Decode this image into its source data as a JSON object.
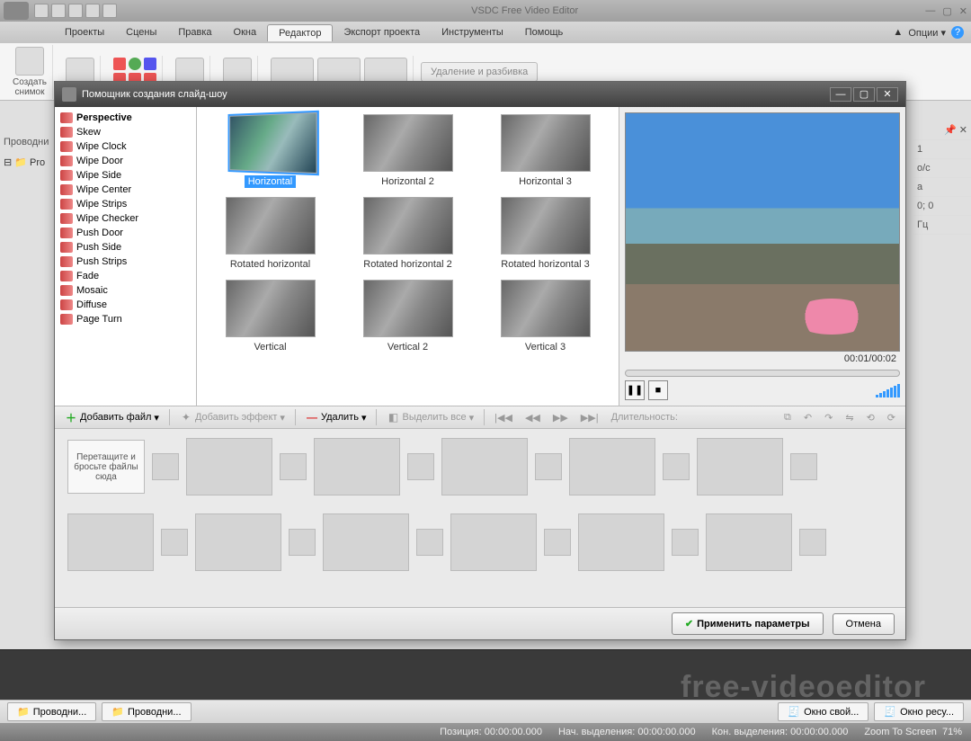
{
  "app": {
    "title": "VSDC Free Video Editor",
    "options_label": "Опции ▾"
  },
  "menu": {
    "items": [
      "Проекты",
      "Сцены",
      "Правка",
      "Окна",
      "Редактор",
      "Экспорт проекта",
      "Инструменты",
      "Помощь"
    ],
    "active_index": 4
  },
  "ribbon": {
    "snapshot": "Создать\nснимок",
    "del_split": "Удаление и разбивка"
  },
  "left_panel": {
    "header": "Проводни",
    "tree_root": "Pro"
  },
  "right_props": {
    "values": [
      "1",
      "о/с",
      "а",
      "0; 0",
      "Гц"
    ]
  },
  "modal": {
    "title": "Помощник создания слайд-шоу",
    "transitions": [
      "Perspective",
      "Skew",
      "Wipe Clock",
      "Wipe Door",
      "Wipe Side",
      "Wipe Center",
      "Wipe Strips",
      "Wipe Checker",
      "Push Door",
      "Push Side",
      "Push Strips",
      "Fade",
      "Mosaic",
      "Diffuse",
      "Page Turn"
    ],
    "selected_transition_index": 0,
    "gallery": [
      "Horizontal",
      "Horizontal 2",
      "Horizontal 3",
      "Rotated horizontal",
      "Rotated horizontal 2",
      "Rotated horizontal 3",
      "Vertical",
      "Vertical 2",
      "Vertical 3"
    ],
    "selected_item_index": 0,
    "preview": {
      "time": "00:01/00:02",
      "play_icon": "❚❚",
      "stop_icon": "■"
    },
    "toolbar": {
      "add_file": "Добавить файл",
      "add_effect": "Добавить эффект",
      "delete": "Удалить",
      "select_all": "Выделить все",
      "duration": "Длительность:"
    },
    "storyboard_hint": "Перетащите и бросьте файлы сюда",
    "apply": "Применить параметры",
    "cancel": "Отмена"
  },
  "bottom": {
    "tabs_left": [
      "Проводни...",
      "Проводни..."
    ],
    "tabs_right": [
      "Окно свой...",
      "Окно ресу..."
    ],
    "status": {
      "position_label": "Позиция:",
      "position_value": "00:00:00.000",
      "sel_start_label": "Нач. выделения:",
      "sel_start_value": "00:00:00.000",
      "sel_end_label": "Кон. выделения:",
      "sel_end_value": "00:00:00.000",
      "zoom_label": "Zoom To Screen",
      "zoom_value": "71%"
    }
  },
  "watermark": "free-videoeditor"
}
